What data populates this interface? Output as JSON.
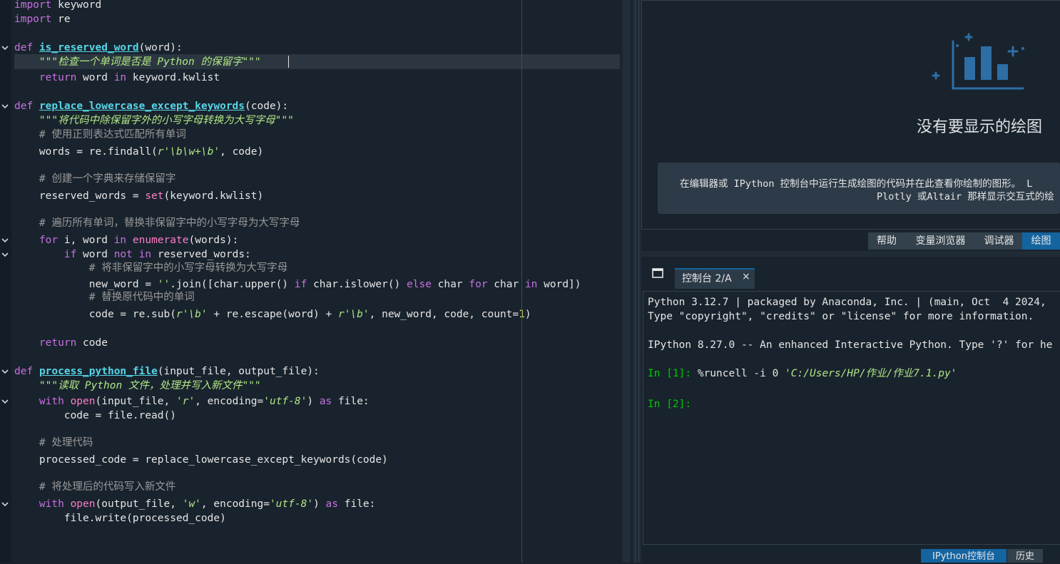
{
  "editor": {
    "lines": [
      [
        {
          "t": "import",
          "c": "kw"
        },
        {
          "t": " keyword"
        }
      ],
      [
        {
          "t": "import",
          "c": "kw"
        },
        {
          "t": " re"
        }
      ],
      [],
      [
        {
          "t": "def",
          "c": "kw"
        },
        {
          "t": " "
        },
        {
          "t": "is_reserved_word",
          "c": "fn"
        },
        {
          "t": "(word):"
        }
      ],
      [
        {
          "t": "    "
        },
        {
          "t": "\"\"\"检查一个单词是否是 Python 的保留字\"\"\"",
          "c": "str"
        }
      ],
      [
        {
          "t": "    "
        },
        {
          "t": "return",
          "c": "kw"
        },
        {
          "t": " word "
        },
        {
          "t": "in",
          "c": "kw"
        },
        {
          "t": " keyword.kwlist"
        }
      ],
      [],
      [
        {
          "t": "def",
          "c": "kw"
        },
        {
          "t": " "
        },
        {
          "t": "replace_lowercase_except_keywords",
          "c": "fn"
        },
        {
          "t": "(code):"
        }
      ],
      [
        {
          "t": "    "
        },
        {
          "t": "\"\"\"将代码中除保留字外的小写字母转换为大写字母\"\"\"",
          "c": "str"
        }
      ],
      [
        {
          "t": "    "
        },
        {
          "t": "# 使用正则表达式匹配所有单词",
          "c": "cmt"
        }
      ],
      [
        {
          "t": "    words = re.findall("
        },
        {
          "t": "r'\\b\\w+\\b'",
          "c": "str"
        },
        {
          "t": ", code)"
        }
      ],
      [],
      [
        {
          "t": "    "
        },
        {
          "t": "# 创建一个字典来存储保留字",
          "c": "cmt"
        }
      ],
      [
        {
          "t": "    reserved_words = "
        },
        {
          "t": "set",
          "c": "bi"
        },
        {
          "t": "(keyword.kwlist)"
        }
      ],
      [],
      [
        {
          "t": "    "
        },
        {
          "t": "# 遍历所有单词，替换非保留字中的小写字母为大写字母",
          "c": "cmt"
        }
      ],
      [
        {
          "t": "    "
        },
        {
          "t": "for",
          "c": "kw"
        },
        {
          "t": " i, word "
        },
        {
          "t": "in",
          "c": "kw"
        },
        {
          "t": " "
        },
        {
          "t": "enumerate",
          "c": "bi"
        },
        {
          "t": "(words):"
        }
      ],
      [
        {
          "t": "        "
        },
        {
          "t": "if",
          "c": "kw"
        },
        {
          "t": " word "
        },
        {
          "t": "not",
          "c": "kw"
        },
        {
          "t": " "
        },
        {
          "t": "in",
          "c": "kw"
        },
        {
          "t": " reserved_words:"
        }
      ],
      [
        {
          "t": "            "
        },
        {
          "t": "# 将非保留字中的小写字母转换为大写字母",
          "c": "cmt"
        }
      ],
      [
        {
          "t": "            new_word = "
        },
        {
          "t": "''",
          "c": "str"
        },
        {
          "t": ".join([char.upper() "
        },
        {
          "t": "if",
          "c": "kw"
        },
        {
          "t": " char.islower() "
        },
        {
          "t": "else",
          "c": "kw"
        },
        {
          "t": " char "
        },
        {
          "t": "for",
          "c": "kw"
        },
        {
          "t": " char "
        },
        {
          "t": "in",
          "c": "kw"
        },
        {
          "t": " word])"
        }
      ],
      [
        {
          "t": "            "
        },
        {
          "t": "# 替换原代码中的单词",
          "c": "cmt"
        }
      ],
      [
        {
          "t": "            code = re.sub("
        },
        {
          "t": "r'\\b'",
          "c": "str"
        },
        {
          "t": " + re.escape(word) + "
        },
        {
          "t": "r'\\b'",
          "c": "str"
        },
        {
          "t": ", new_word, code, count="
        },
        {
          "t": "1",
          "c": "num"
        },
        {
          "t": ")"
        }
      ],
      [],
      [
        {
          "t": "    "
        },
        {
          "t": "return",
          "c": "kw"
        },
        {
          "t": " code"
        }
      ],
      [],
      [
        {
          "t": "def",
          "c": "kw"
        },
        {
          "t": " "
        },
        {
          "t": "process_python_file",
          "c": "fn"
        },
        {
          "t": "(input_file, output_file):"
        }
      ],
      [
        {
          "t": "    "
        },
        {
          "t": "\"\"\"读取 Python 文件，处理并写入新文件\"\"\"",
          "c": "str"
        }
      ],
      [
        {
          "t": "    "
        },
        {
          "t": "with",
          "c": "kw"
        },
        {
          "t": " "
        },
        {
          "t": "open",
          "c": "bi"
        },
        {
          "t": "(input_file, "
        },
        {
          "t": "'r'",
          "c": "str"
        },
        {
          "t": ", encoding="
        },
        {
          "t": "'utf-8'",
          "c": "str"
        },
        {
          "t": ") "
        },
        {
          "t": "as",
          "c": "kw"
        },
        {
          "t": " file:"
        }
      ],
      [
        {
          "t": "        code = file.read()"
        }
      ],
      [],
      [
        {
          "t": "    "
        },
        {
          "t": "# 处理代码",
          "c": "cmt"
        }
      ],
      [
        {
          "t": "    processed_code = replace_lowercase_except_keywords(code)"
        }
      ],
      [],
      [
        {
          "t": "    "
        },
        {
          "t": "# 将处理后的代码写入新文件",
          "c": "cmt"
        }
      ],
      [
        {
          "t": "    "
        },
        {
          "t": "with",
          "c": "kw"
        },
        {
          "t": " "
        },
        {
          "t": "open",
          "c": "bi"
        },
        {
          "t": "(output_file, "
        },
        {
          "t": "'w'",
          "c": "str"
        },
        {
          "t": ", encoding="
        },
        {
          "t": "'utf-8'",
          "c": "str"
        },
        {
          "t": ") "
        },
        {
          "t": "as",
          "c": "kw"
        },
        {
          "t": " file:"
        }
      ],
      [
        {
          "t": "        file.write(processed_code)"
        }
      ]
    ],
    "fold_markers": [
      3,
      7,
      16,
      17,
      25,
      27,
      34
    ]
  },
  "plots": {
    "empty_title": "没有要显示的绘图",
    "hint_line1": "在编辑器或 IPython 控制台中运行生成绘图的代码并在此查看你绘制的图形。 L",
    "hint_line2": "Plotly 或Altair 那样显示交互式的绘"
  },
  "top_tabs": [
    {
      "label": "帮助",
      "active": false
    },
    {
      "label": "变量浏览器",
      "active": false
    },
    {
      "label": "调试器",
      "active": false
    },
    {
      "label": "绘图",
      "active": true
    }
  ],
  "console": {
    "tab_label": "控制台 2/A",
    "close_glyph": "×",
    "banner1": "Python 3.12.7 | packaged by Anaconda, Inc. | (main, Oct  4 2024,",
    "banner2": "Type \"copyright\", \"credits\" or \"license\" for more information.",
    "banner3": "IPython 8.27.0 -- An enhanced Interactive Python. Type '?' for he",
    "prompt1": "In [1]: ",
    "cmd1_a": "%runcell -i ",
    "cmd1_num": "0",
    "cmd1_space": " ",
    "cmd1_str": "'C:/Users/HP/作业/作业7.1.py'",
    "prompt2": "In [2]:"
  },
  "bottom_tabs": [
    {
      "label": "IPython控制台",
      "active": true
    },
    {
      "label": "历史",
      "active": false
    }
  ],
  "colors": {
    "background": "#19232d",
    "accent": "#1464a0",
    "keyword": "#c670e0",
    "function": "#57d6e8",
    "string": "#b0e686",
    "comment": "#999999",
    "prompt": "#00c800"
  }
}
